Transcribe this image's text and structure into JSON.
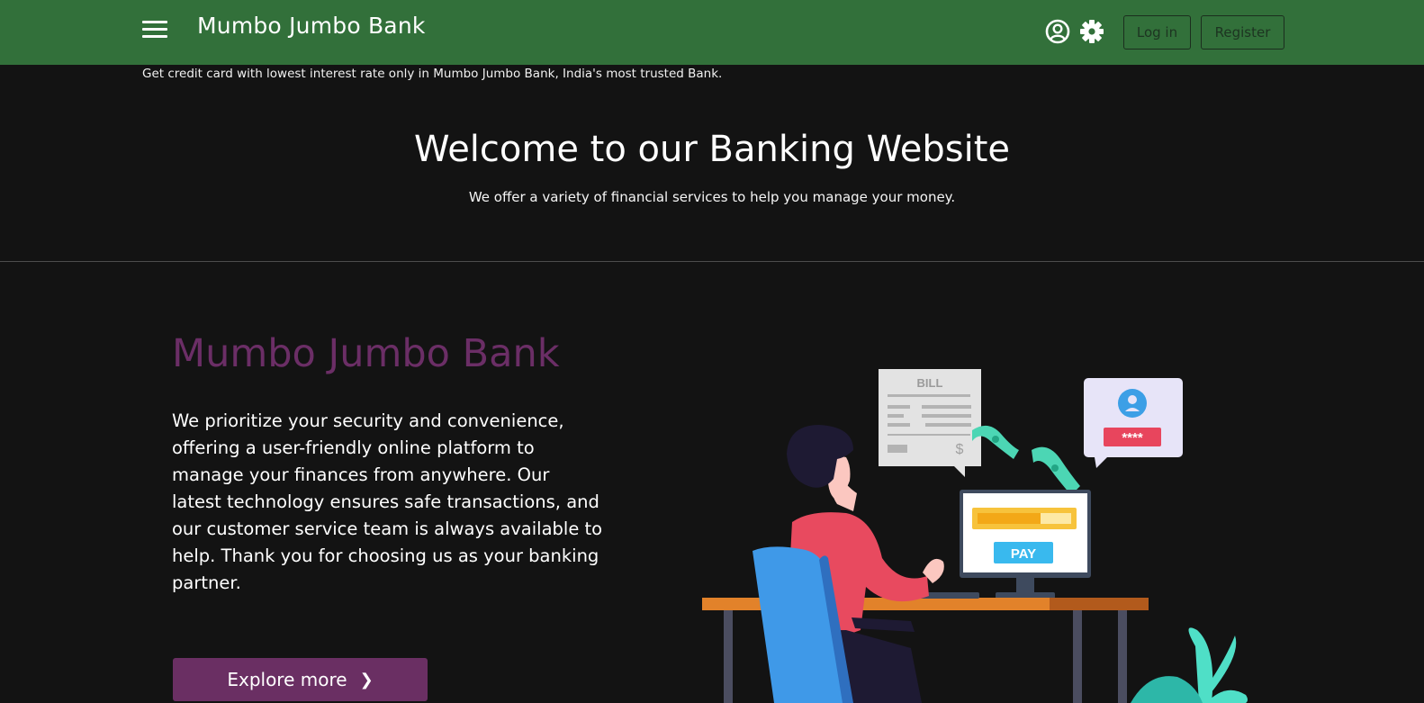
{
  "header": {
    "brand": "Mumbo Jumbo Bank",
    "login_label": "Log in",
    "register_label": "Register"
  },
  "promo": {
    "text": "Get credit card with lowest interest rate only in Mumbo Jumbo Bank, India's most trusted Bank."
  },
  "welcome": {
    "title": "Welcome to our Banking Website",
    "subtitle": "We offer a variety of financial services to help you manage your money."
  },
  "hero": {
    "title": "Mumbo Jumbo Bank",
    "description": "We prioritize your security and convenience, offering a user-friendly online platform to manage your finances from anywhere. Our latest technology ensures safe transactions, and our customer service team is always available to help. Thank you for choosing us as your banking partner.",
    "cta_label": "Explore more"
  },
  "illustration": {
    "bill_label": "BILL",
    "bill_currency": "$",
    "password_mask": "****",
    "pay_label": "PAY"
  },
  "icons": {
    "menu": "hamburger-icon",
    "account": "user-circle-icon",
    "settings": "gear-icon",
    "cta": "chevron-right-icon"
  },
  "colors": {
    "navbar": "#32703a",
    "background": "#131313",
    "accent_purple": "#6a2f63"
  }
}
